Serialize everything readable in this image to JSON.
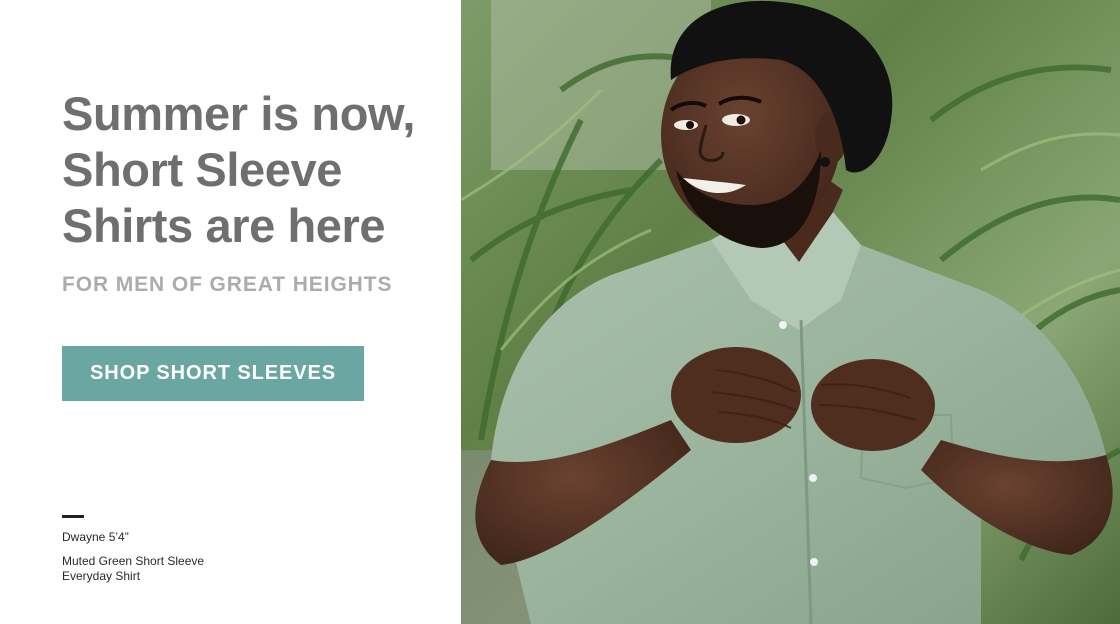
{
  "promo": {
    "headline_line1": "Summer is now,",
    "headline_line2": "Short Sleeve",
    "headline_line3": "Shirts are here",
    "subheadline": "FOR MEN OF GREAT HEIGHTS",
    "cta_label": "SHOP SHORT SLEEVES",
    "model_caption": "Dwayne 5’4”",
    "product_line1": "Muted Green Short Sleeve",
    "product_line2": "Everyday Shirt"
  },
  "colors": {
    "headline": "#6f6f6f",
    "subheadline": "#acacac",
    "cta_background": "#6ba7a2",
    "cta_text": "#ffffff",
    "caption_text": "#2a2a2a",
    "shirt": "#9fb8a3"
  },
  "image": {
    "subject": "smiling man in muted green short sleeve button-up shirt in front of palm foliage"
  }
}
